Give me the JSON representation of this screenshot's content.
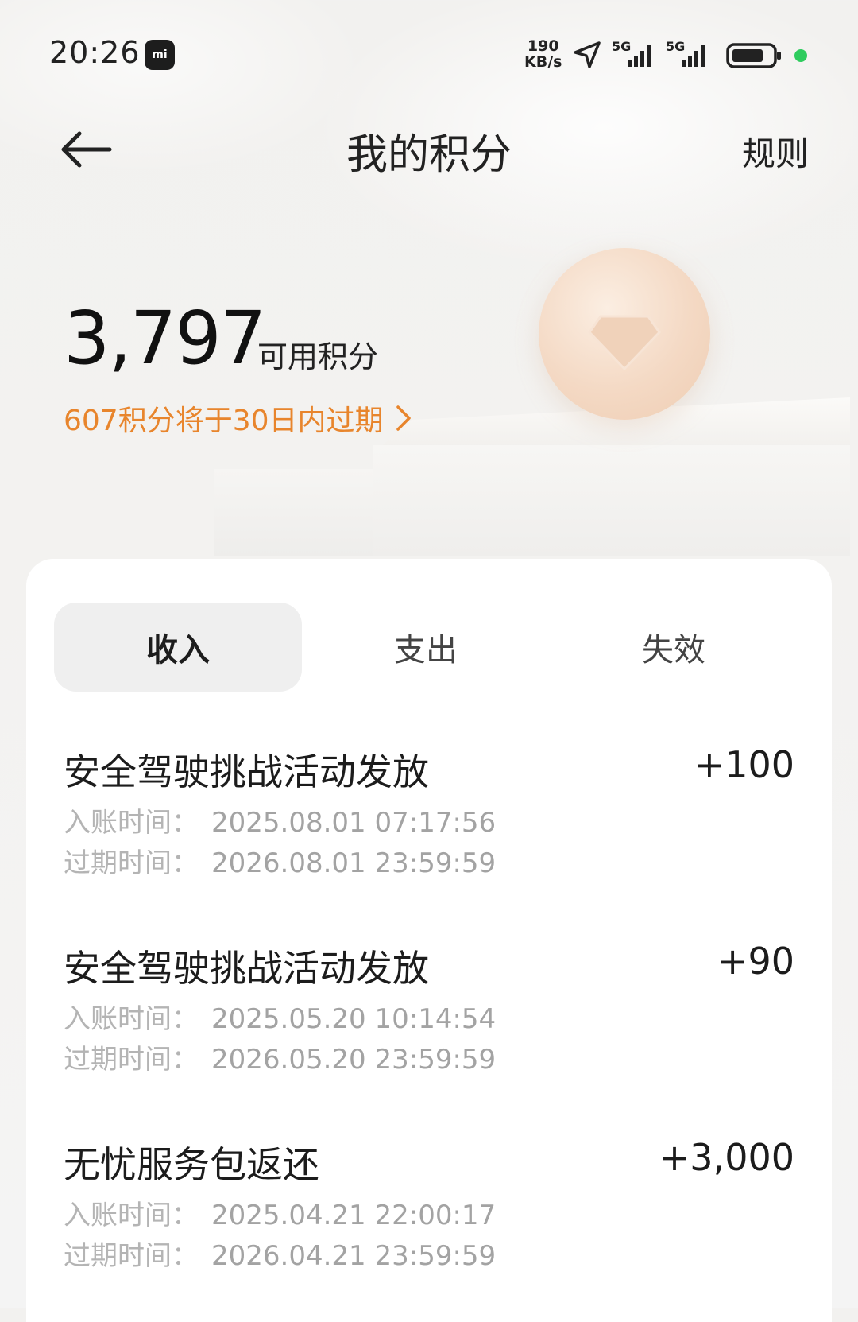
{
  "status_bar": {
    "time": "20:26",
    "mi_badge": "mi",
    "net_speed_value": "190",
    "net_speed_unit": "KB/s",
    "signal_label_1": "5G",
    "signal_label_2": "5G"
  },
  "header": {
    "title": "我的积分",
    "rules_label": "规则"
  },
  "summary": {
    "points": "3,797",
    "points_label": "可用积分",
    "expire_notice": "607积分将于30日内过期"
  },
  "tabs": [
    {
      "label": "收入",
      "active": true
    },
    {
      "label": "支出",
      "active": false
    },
    {
      "label": "失效",
      "active": false
    }
  ],
  "records": [
    {
      "title": "安全驾驶挑战活动发放",
      "amount": "+100",
      "credit_key": "入账时间：",
      "credit_time": "2025.08.01 07:17:56",
      "expire_key": "过期时间：",
      "expire_time": "2026.08.01 23:59:59"
    },
    {
      "title": "安全驾驶挑战活动发放",
      "amount": "+90",
      "credit_key": "入账时间：",
      "credit_time": "2025.05.20 10:14:54",
      "expire_key": "过期时间：",
      "expire_time": "2026.05.20 23:59:59"
    },
    {
      "title": "无忧服务包返还",
      "amount": "+3,000",
      "credit_key": "入账时间：",
      "credit_time": "2025.04.21 22:00:17",
      "expire_key": "过期时间：",
      "expire_time": "2026.04.21 23:59:59"
    }
  ],
  "colors": {
    "accent": "#e8852c",
    "tab_active_bg": "#efefef",
    "battery_dot": "#2fcc5e",
    "muted_text": "#a9a9a9"
  },
  "icons": {
    "back": "arrow-left-icon",
    "expire_chevron": "chevron-right-icon",
    "coin": "diamond-coin-icon",
    "location": "location-arrow-icon",
    "signal": "signal-bars-icon",
    "battery": "battery-icon"
  }
}
